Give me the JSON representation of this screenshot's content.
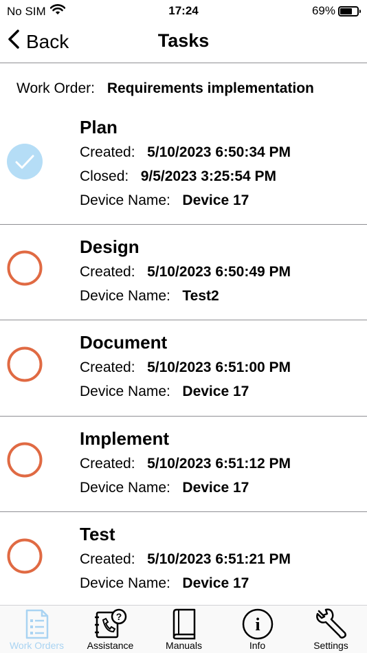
{
  "status_bar": {
    "carrier": "No SIM",
    "time": "17:24",
    "battery_percent_label": "69%",
    "battery_level": 0.69
  },
  "nav": {
    "back_label": "Back",
    "title": "Tasks"
  },
  "work_order": {
    "label": "Work Order:",
    "value": "Requirements implementation"
  },
  "labels": {
    "created": "Created:",
    "closed": "Closed:",
    "device_name": "Device Name:"
  },
  "tasks": [
    {
      "title": "Plan",
      "completed": true,
      "created": "5/10/2023 6:50:34 PM",
      "closed": "9/5/2023 3:25:54 PM",
      "device": "Device 17"
    },
    {
      "title": "Design",
      "completed": false,
      "created": "5/10/2023 6:50:49 PM",
      "device": "Test2"
    },
    {
      "title": "Document",
      "completed": false,
      "created": "5/10/2023 6:51:00 PM",
      "device": "Device 17"
    },
    {
      "title": "Implement",
      "completed": false,
      "created": "5/10/2023 6:51:12 PM",
      "device": "Device 17"
    },
    {
      "title": "Test",
      "completed": false,
      "created": "5/10/2023 6:51:21 PM",
      "device": "Device 17"
    }
  ],
  "tab_bar": {
    "tabs": [
      {
        "label": "Work Orders",
        "icon": "clipboard-list-icon",
        "active": true
      },
      {
        "label": "Assistance",
        "icon": "phone-book-question-icon",
        "active": false
      },
      {
        "label": "Manuals",
        "icon": "book-icon",
        "active": false
      },
      {
        "label": "Info",
        "icon": "info-circle-icon",
        "active": false
      },
      {
        "label": "Settings",
        "icon": "wrench-icon",
        "active": false
      }
    ]
  },
  "colors": {
    "completed": "#b5ddf6",
    "pending": "#e06a43",
    "active_tab": "#a9d3f2",
    "separator": "#8e8e93"
  }
}
